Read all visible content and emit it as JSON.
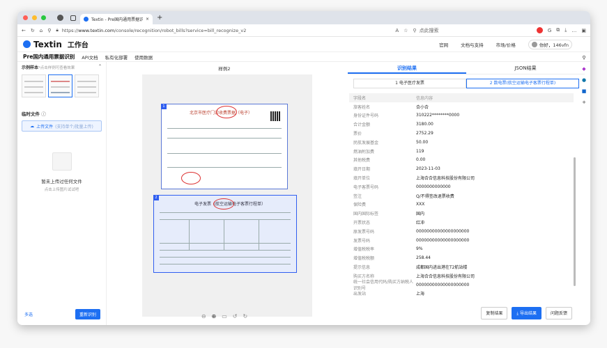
{
  "browser": {
    "tab_title": "Textin - Pre国内通用票据识别",
    "url_prefix": "https://",
    "url_host": "www.textin.com",
    "url_path": "/console/recognition/robot_bills?service=bill_recognize_v2",
    "search_placeholder": "点此搜索",
    "zoom": "A"
  },
  "header": {
    "logo": "Textin",
    "workspace": "工作台",
    "links": [
      "官网",
      "文档与支持",
      "市场/价格"
    ],
    "user": "你好，146vfn"
  },
  "subnav": {
    "title": "Pre国内通用票据识别",
    "items": [
      "API文档",
      "私有化部署",
      "使用数据"
    ]
  },
  "left": {
    "samples_title": "示例样本",
    "samples_hint": "*点击样例可查看效果",
    "temp_title": "临时文件",
    "upload_label": "上传文件",
    "upload_sub": "(支持单个/批量上传)",
    "empty_title": "暂未上传过任何文件",
    "empty_sub": "点击上传图片试试吧",
    "multi_label": "多选",
    "rerun_label": "重新识别"
  },
  "center": {
    "sample_title": "样例2",
    "invoice1": {
      "badge": "1",
      "title": "北京市医疗门诊收费票据（电子）"
    },
    "invoice2": {
      "badge": "2",
      "title": "电子发票（航空运输电子客票行程单）"
    }
  },
  "right": {
    "tabs": [
      "识别结果",
      "JSON结果"
    ],
    "subtabs": [
      "1 电子医疗发票",
      "2 数电票(航空运输电子客票行程单)"
    ],
    "head": {
      "name": "字段名",
      "value": "信息内容"
    },
    "fields": [
      {
        "name": "旅客姓名",
        "value": "合小合"
      },
      {
        "name": "身份证件号码",
        "value": "310222********0000"
      },
      {
        "name": "合计金额",
        "value": "3180.00"
      },
      {
        "name": "票价",
        "value": "2752.29"
      },
      {
        "name": "民航发展基金",
        "value": "50.00"
      },
      {
        "name": "燃油附加费",
        "value": "119"
      },
      {
        "name": "其他税费",
        "value": "0.00"
      },
      {
        "name": "填开日期",
        "value": "2023-11-03"
      },
      {
        "name": "填开单位",
        "value": "上海合合信息科技股份有限公司"
      },
      {
        "name": "电子客票号码",
        "value": "0000000000000"
      },
      {
        "name": "签注",
        "value": "Q/不得签改退票收费"
      },
      {
        "name": "保险费",
        "value": "XXX"
      },
      {
        "name": "国内国际标签",
        "value": "国内"
      },
      {
        "name": "开票状态",
        "value": "红冲"
      },
      {
        "name": "原发票号码",
        "value": "00000000000000000000"
      },
      {
        "name": "发票号码",
        "value": "00000000000000000000"
      },
      {
        "name": "增值税税率",
        "value": "9%"
      },
      {
        "name": "增值税税额",
        "value": "258.44"
      },
      {
        "name": "提示信息",
        "value": "成都国内进出港在T2航站楼"
      },
      {
        "name": "购买方名称",
        "value": "上海合合信息科技股份有限公司"
      },
      {
        "name": "统一社会信用代码/购买方纳税人识别号",
        "value": "00000000000000000000"
      },
      {
        "name": "出发站",
        "value": "上海"
      }
    ],
    "buttons": {
      "copy": "复制结果",
      "export": "导出结果",
      "feedback": "问题反馈"
    }
  },
  "colors": {
    "accent": "#1d6ff2",
    "stamp": "#d33333"
  }
}
